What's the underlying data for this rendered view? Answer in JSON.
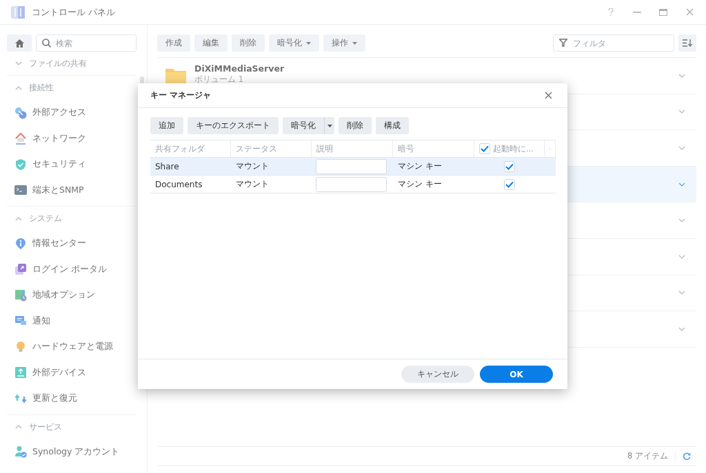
{
  "window": {
    "title": "コントロール パネル"
  },
  "sidebar": {
    "search": {
      "placeholder": "検索"
    },
    "sections": [
      {
        "title": "ファイルの共有",
        "expanded": false
      },
      {
        "title": "接続性",
        "expanded": true,
        "items": [
          {
            "label": "外部アクセス"
          },
          {
            "label": "ネットワーク"
          },
          {
            "label": "セキュリティ"
          },
          {
            "label": "端末とSNMP"
          }
        ]
      },
      {
        "title": "システム",
        "expanded": true,
        "items": [
          {
            "label": "情報センター"
          },
          {
            "label": "ログイン ポータル"
          },
          {
            "label": "地域オプション"
          },
          {
            "label": "通知"
          },
          {
            "label": "ハードウェアと電源"
          },
          {
            "label": "外部デバイス"
          },
          {
            "label": "更新と復元"
          }
        ]
      },
      {
        "title": "サービス",
        "expanded": true,
        "items": [
          {
            "label": "Synology アカウント"
          }
        ]
      }
    ]
  },
  "toolbar": {
    "buttons": [
      {
        "label": "作成",
        "dropdown": false
      },
      {
        "label": "編集",
        "dropdown": false
      },
      {
        "label": "削除",
        "dropdown": false
      },
      {
        "label": "暗号化",
        "dropdown": true
      },
      {
        "label": "操作",
        "dropdown": true
      }
    ],
    "filter": {
      "placeholder": "フィルタ"
    }
  },
  "folders": [
    {
      "name": "DiXiMMediaServer",
      "location": "ボリューム 1",
      "selected": false
    },
    {
      "selected": false
    },
    {
      "selected": false
    },
    {
      "selected": true
    },
    {
      "selected": false
    },
    {
      "selected": false
    },
    {
      "selected": false
    },
    {
      "selected": false
    }
  ],
  "status_bar": {
    "count": "8 アイテム"
  },
  "dialog": {
    "title": "キー マネージャ",
    "buttons": [
      {
        "label": "追加",
        "split": false
      },
      {
        "label": "キーのエクスポート",
        "split": false
      },
      {
        "label": "暗号化",
        "split": true
      },
      {
        "label": "削除",
        "split": false
      },
      {
        "label": "構成",
        "split": false
      }
    ],
    "columns": [
      {
        "label": "共有フォルダ",
        "kind": "text"
      },
      {
        "label": "ステータス",
        "kind": "text"
      },
      {
        "label": "説明",
        "kind": "input"
      },
      {
        "label": "暗号",
        "kind": "text"
      },
      {
        "label": "起動時に...",
        "kind": "check",
        "checked": true
      }
    ],
    "rows": [
      {
        "selected": true,
        "cells": [
          "Share",
          "マウント",
          "",
          "マシン キー"
        ],
        "checked": true
      },
      {
        "selected": false,
        "cells": [
          "Documents",
          "マウント",
          "",
          "マシン キー"
        ],
        "checked": true
      }
    ],
    "footer": [
      {
        "label": "キャンセル",
        "kind": "secondary"
      },
      {
        "label": "OK",
        "kind": "primary"
      }
    ]
  }
}
